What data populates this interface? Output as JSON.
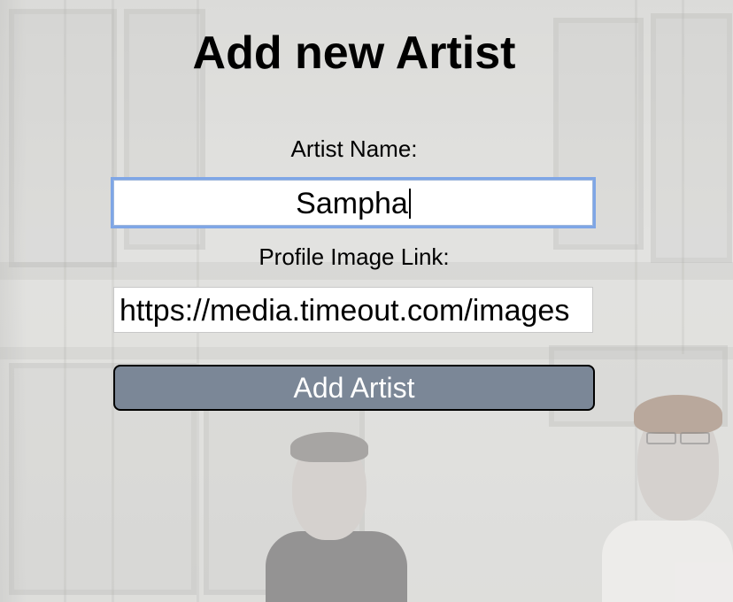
{
  "page": {
    "title": "Add new Artist"
  },
  "form": {
    "artist_name_label": "Artist Name:",
    "artist_name_value": "Sampha",
    "profile_image_label": "Profile Image Link:",
    "profile_image_value": "https://media.timeout.com/images",
    "submit_label": "Add Artist"
  },
  "colors": {
    "button_background": "#7b8797",
    "focus_ring": "#7fa6e6"
  }
}
